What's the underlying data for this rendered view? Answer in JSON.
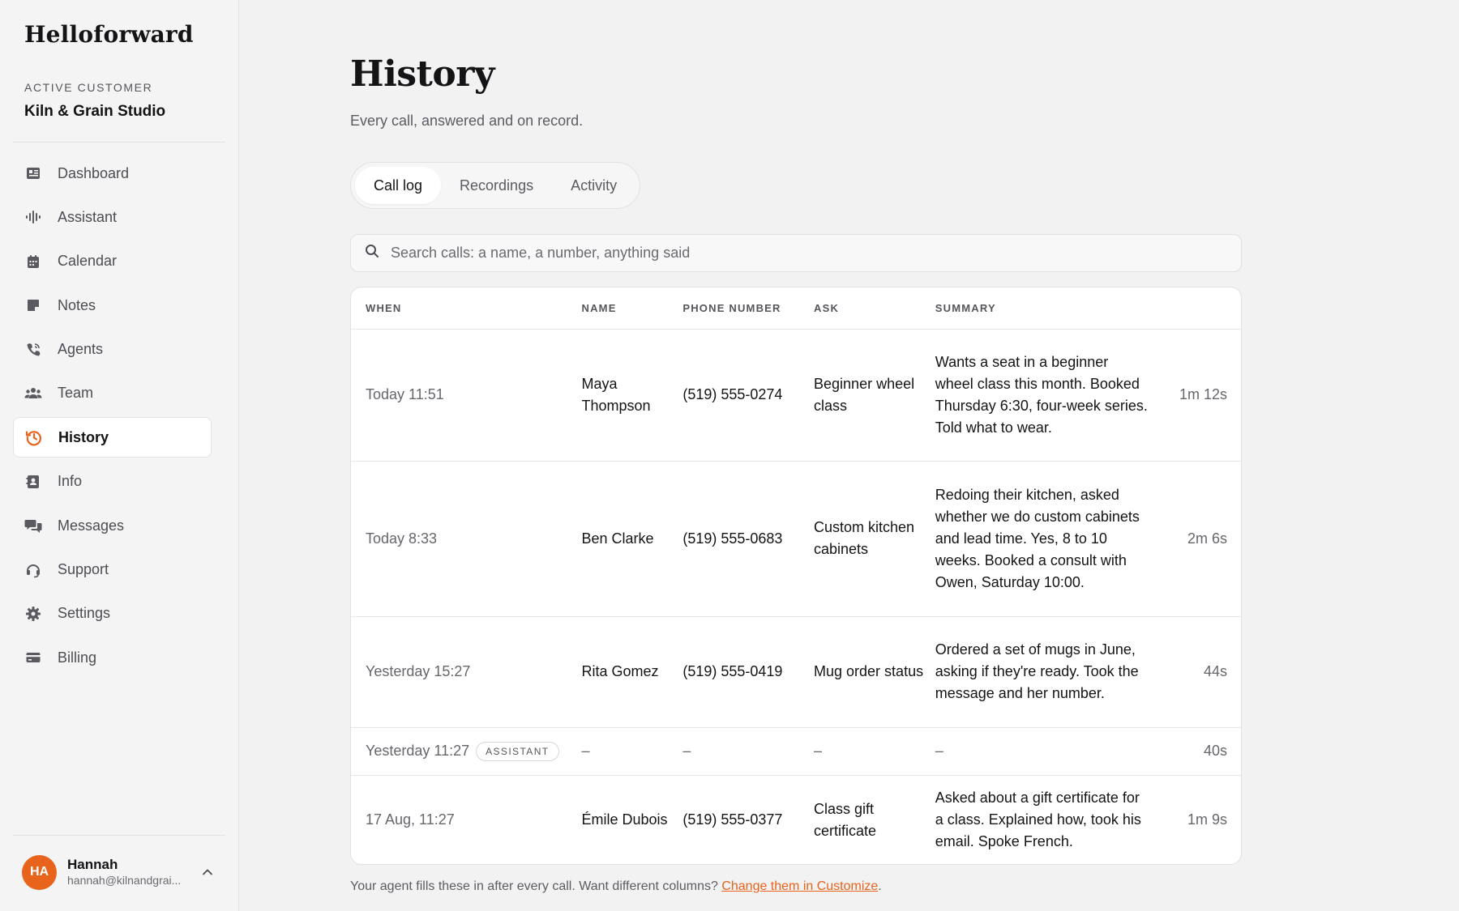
{
  "app": {
    "name": "Helloforward",
    "accent_color": "#e8631c"
  },
  "customer": {
    "label": "ACTIVE CUSTOMER",
    "name": "Kiln & Grain Studio"
  },
  "nav": [
    {
      "label": "Dashboard",
      "icon": "newspaper-icon"
    },
    {
      "label": "Assistant",
      "icon": "waveform-icon"
    },
    {
      "label": "Calendar",
      "icon": "calendar-icon"
    },
    {
      "label": "Notes",
      "icon": "note-icon"
    },
    {
      "label": "Agents",
      "icon": "phone-icon"
    },
    {
      "label": "Team",
      "icon": "team-icon"
    },
    {
      "label": "History",
      "icon": "history-icon",
      "active": true
    },
    {
      "label": "Info",
      "icon": "contact-card-icon"
    },
    {
      "label": "Messages",
      "icon": "chat-icon"
    },
    {
      "label": "Support",
      "icon": "headset-icon"
    },
    {
      "label": "Settings",
      "icon": "gear-icon"
    },
    {
      "label": "Billing",
      "icon": "credit-card-icon"
    }
  ],
  "user": {
    "initials": "HA",
    "name": "Hannah",
    "email": "hannah@kilnandgrai..."
  },
  "page": {
    "title": "History",
    "subtitle": "Every call, answered and on record."
  },
  "tabs": [
    {
      "label": "Call log",
      "active": true
    },
    {
      "label": "Recordings"
    },
    {
      "label": "Activity"
    }
  ],
  "search": {
    "placeholder": "Search calls: a name, a number, anything said",
    "value": ""
  },
  "table": {
    "columns": [
      "WHEN",
      "NAME",
      "PHONE NUMBER",
      "ASK",
      "SUMMARY",
      ""
    ],
    "rows": [
      {
        "when": "Today 11:51",
        "badge": "",
        "name": "Maya Thompson",
        "phone": "(519) 555-0274",
        "ask": "Beginner wheel class",
        "summary": "Wants a seat in a beginner wheel class this month. Booked Thursday 6:30, four-week series. Told what to wear.",
        "duration": "1m 12s"
      },
      {
        "when": "Today 8:33",
        "badge": "",
        "name": "Ben Clarke",
        "phone": "(519) 555-0683",
        "ask": "Custom kitchen cabinets",
        "summary": "Redoing their kitchen, asked whether we do custom cabinets and lead time. Yes, 8 to 10 weeks. Booked a consult with Owen, Saturday 10:00.",
        "duration": "2m 6s"
      },
      {
        "when": "Yesterday 15:27",
        "badge": "",
        "name": "Rita Gomez",
        "phone": "(519) 555-0419",
        "ask": "Mug order status",
        "summary": "Ordered a set of mugs in June, asking if they're ready. Took the message and her number.",
        "duration": "44s"
      },
      {
        "when": "Yesterday 11:27",
        "badge": "ASSISTANT",
        "name": "–",
        "phone": "–",
        "ask": "–",
        "summary": "–",
        "duration": "40s"
      },
      {
        "when": "17 Aug, 11:27",
        "badge": "",
        "name": "Émile Dubois",
        "phone": "(519) 555-0377",
        "ask": "Class gift certificate",
        "summary": "Asked about a gift certificate for a class. Explained how, took his email. Spoke French.",
        "duration": "1m 9s"
      }
    ]
  },
  "footer": {
    "text": "Your agent fills these in after every call. Want different columns? ",
    "link": "Change them in Customize",
    "end": "."
  }
}
